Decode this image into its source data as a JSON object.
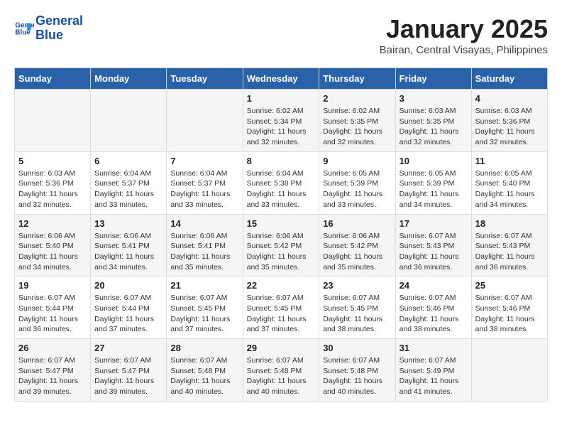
{
  "header": {
    "logo_line1": "General",
    "logo_line2": "Blue",
    "month": "January 2025",
    "location": "Bairan, Central Visayas, Philippines"
  },
  "weekdays": [
    "Sunday",
    "Monday",
    "Tuesday",
    "Wednesday",
    "Thursday",
    "Friday",
    "Saturday"
  ],
  "weeks": [
    [
      {
        "day": "",
        "sunrise": "",
        "sunset": "",
        "daylight": ""
      },
      {
        "day": "",
        "sunrise": "",
        "sunset": "",
        "daylight": ""
      },
      {
        "day": "",
        "sunrise": "",
        "sunset": "",
        "daylight": ""
      },
      {
        "day": "1",
        "sunrise": "Sunrise: 6:02 AM",
        "sunset": "Sunset: 5:34 PM",
        "daylight": "Daylight: 11 hours and 32 minutes."
      },
      {
        "day": "2",
        "sunrise": "Sunrise: 6:02 AM",
        "sunset": "Sunset: 5:35 PM",
        "daylight": "Daylight: 11 hours and 32 minutes."
      },
      {
        "day": "3",
        "sunrise": "Sunrise: 6:03 AM",
        "sunset": "Sunset: 5:35 PM",
        "daylight": "Daylight: 11 hours and 32 minutes."
      },
      {
        "day": "4",
        "sunrise": "Sunrise: 6:03 AM",
        "sunset": "Sunset: 5:36 PM",
        "daylight": "Daylight: 11 hours and 32 minutes."
      }
    ],
    [
      {
        "day": "5",
        "sunrise": "Sunrise: 6:03 AM",
        "sunset": "Sunset: 5:36 PM",
        "daylight": "Daylight: 11 hours and 32 minutes."
      },
      {
        "day": "6",
        "sunrise": "Sunrise: 6:04 AM",
        "sunset": "Sunset: 5:37 PM",
        "daylight": "Daylight: 11 hours and 33 minutes."
      },
      {
        "day": "7",
        "sunrise": "Sunrise: 6:04 AM",
        "sunset": "Sunset: 5:37 PM",
        "daylight": "Daylight: 11 hours and 33 minutes."
      },
      {
        "day": "8",
        "sunrise": "Sunrise: 6:04 AM",
        "sunset": "Sunset: 5:38 PM",
        "daylight": "Daylight: 11 hours and 33 minutes."
      },
      {
        "day": "9",
        "sunrise": "Sunrise: 6:05 AM",
        "sunset": "Sunset: 5:39 PM",
        "daylight": "Daylight: 11 hours and 33 minutes."
      },
      {
        "day": "10",
        "sunrise": "Sunrise: 6:05 AM",
        "sunset": "Sunset: 5:39 PM",
        "daylight": "Daylight: 11 hours and 34 minutes."
      },
      {
        "day": "11",
        "sunrise": "Sunrise: 6:05 AM",
        "sunset": "Sunset: 5:40 PM",
        "daylight": "Daylight: 11 hours and 34 minutes."
      }
    ],
    [
      {
        "day": "12",
        "sunrise": "Sunrise: 6:06 AM",
        "sunset": "Sunset: 5:40 PM",
        "daylight": "Daylight: 11 hours and 34 minutes."
      },
      {
        "day": "13",
        "sunrise": "Sunrise: 6:06 AM",
        "sunset": "Sunset: 5:41 PM",
        "daylight": "Daylight: 11 hours and 34 minutes."
      },
      {
        "day": "14",
        "sunrise": "Sunrise: 6:06 AM",
        "sunset": "Sunset: 5:41 PM",
        "daylight": "Daylight: 11 hours and 35 minutes."
      },
      {
        "day": "15",
        "sunrise": "Sunrise: 6:06 AM",
        "sunset": "Sunset: 5:42 PM",
        "daylight": "Daylight: 11 hours and 35 minutes."
      },
      {
        "day": "16",
        "sunrise": "Sunrise: 6:06 AM",
        "sunset": "Sunset: 5:42 PM",
        "daylight": "Daylight: 11 hours and 35 minutes."
      },
      {
        "day": "17",
        "sunrise": "Sunrise: 6:07 AM",
        "sunset": "Sunset: 5:43 PM",
        "daylight": "Daylight: 11 hours and 36 minutes."
      },
      {
        "day": "18",
        "sunrise": "Sunrise: 6:07 AM",
        "sunset": "Sunset: 5:43 PM",
        "daylight": "Daylight: 11 hours and 36 minutes."
      }
    ],
    [
      {
        "day": "19",
        "sunrise": "Sunrise: 6:07 AM",
        "sunset": "Sunset: 5:44 PM",
        "daylight": "Daylight: 11 hours and 36 minutes."
      },
      {
        "day": "20",
        "sunrise": "Sunrise: 6:07 AM",
        "sunset": "Sunset: 5:44 PM",
        "daylight": "Daylight: 11 hours and 37 minutes."
      },
      {
        "day": "21",
        "sunrise": "Sunrise: 6:07 AM",
        "sunset": "Sunset: 5:45 PM",
        "daylight": "Daylight: 11 hours and 37 minutes."
      },
      {
        "day": "22",
        "sunrise": "Sunrise: 6:07 AM",
        "sunset": "Sunset: 5:45 PM",
        "daylight": "Daylight: 11 hours and 37 minutes."
      },
      {
        "day": "23",
        "sunrise": "Sunrise: 6:07 AM",
        "sunset": "Sunset: 5:45 PM",
        "daylight": "Daylight: 11 hours and 38 minutes."
      },
      {
        "day": "24",
        "sunrise": "Sunrise: 6:07 AM",
        "sunset": "Sunset: 5:46 PM",
        "daylight": "Daylight: 11 hours and 38 minutes."
      },
      {
        "day": "25",
        "sunrise": "Sunrise: 6:07 AM",
        "sunset": "Sunset: 5:46 PM",
        "daylight": "Daylight: 11 hours and 38 minutes."
      }
    ],
    [
      {
        "day": "26",
        "sunrise": "Sunrise: 6:07 AM",
        "sunset": "Sunset: 5:47 PM",
        "daylight": "Daylight: 11 hours and 39 minutes."
      },
      {
        "day": "27",
        "sunrise": "Sunrise: 6:07 AM",
        "sunset": "Sunset: 5:47 PM",
        "daylight": "Daylight: 11 hours and 39 minutes."
      },
      {
        "day": "28",
        "sunrise": "Sunrise: 6:07 AM",
        "sunset": "Sunset: 5:48 PM",
        "daylight": "Daylight: 11 hours and 40 minutes."
      },
      {
        "day": "29",
        "sunrise": "Sunrise: 6:07 AM",
        "sunset": "Sunset: 5:48 PM",
        "daylight": "Daylight: 11 hours and 40 minutes."
      },
      {
        "day": "30",
        "sunrise": "Sunrise: 6:07 AM",
        "sunset": "Sunset: 5:48 PM",
        "daylight": "Daylight: 11 hours and 40 minutes."
      },
      {
        "day": "31",
        "sunrise": "Sunrise: 6:07 AM",
        "sunset": "Sunset: 5:49 PM",
        "daylight": "Daylight: 11 hours and 41 minutes."
      },
      {
        "day": "",
        "sunrise": "",
        "sunset": "",
        "daylight": ""
      }
    ]
  ]
}
